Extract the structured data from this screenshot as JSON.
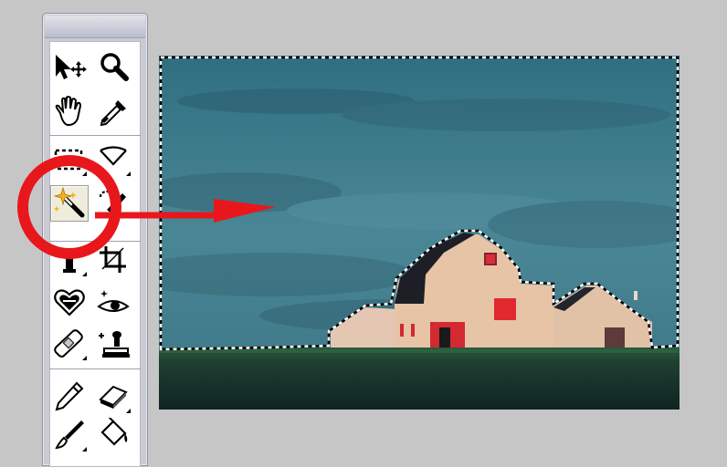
{
  "toolbox": {
    "tools": [
      {
        "name": "move-tool",
        "icon": "move-arrow-icon"
      },
      {
        "name": "zoom-tool",
        "icon": "magnifier-icon"
      },
      {
        "name": "hand-tool",
        "icon": "hand-icon"
      },
      {
        "name": "eyedropper-tool",
        "icon": "eyedropper-icon"
      },
      {
        "name": "rectangular-marquee-tool",
        "icon": "marquee-icon"
      },
      {
        "name": "lasso-tool",
        "icon": "lasso-icon"
      },
      {
        "name": "magic-wand-tool",
        "icon": "magic-wand-icon",
        "selected": true
      },
      {
        "name": "quick-selection-tool",
        "icon": "quick-selection-icon"
      },
      {
        "name": "type-tool",
        "icon": "type-icon"
      },
      {
        "name": "crop-tool",
        "icon": "crop-icon"
      },
      {
        "name": "cookie-cutter-tool",
        "icon": "heart-cutter-icon"
      },
      {
        "name": "red-eye-tool",
        "icon": "red-eye-icon"
      },
      {
        "name": "healing-brush-tool",
        "icon": "bandage-icon"
      },
      {
        "name": "clone-stamp-tool",
        "icon": "stamp-icon"
      },
      {
        "name": "pencil-tool",
        "icon": "pencil-icon"
      },
      {
        "name": "eraser-tool",
        "icon": "eraser-icon"
      },
      {
        "name": "brush-tool",
        "icon": "brush-icon"
      },
      {
        "name": "paint-bucket-tool",
        "icon": "paint-bucket-icon"
      }
    ]
  },
  "canvas": {
    "photo": "barn-under-blue-sky",
    "selection": "marching-ants-sky-selection"
  },
  "annotation": {
    "highlight": "red-circle",
    "pointer": "red-arrow-right",
    "color": "#e8171c"
  },
  "colors": {
    "workspace": "#c6c6c6",
    "sky": "#3f7f8e",
    "barn": "#e6c4a9",
    "barn_trim": "#e02a30",
    "grass": "#1c3b2e"
  }
}
